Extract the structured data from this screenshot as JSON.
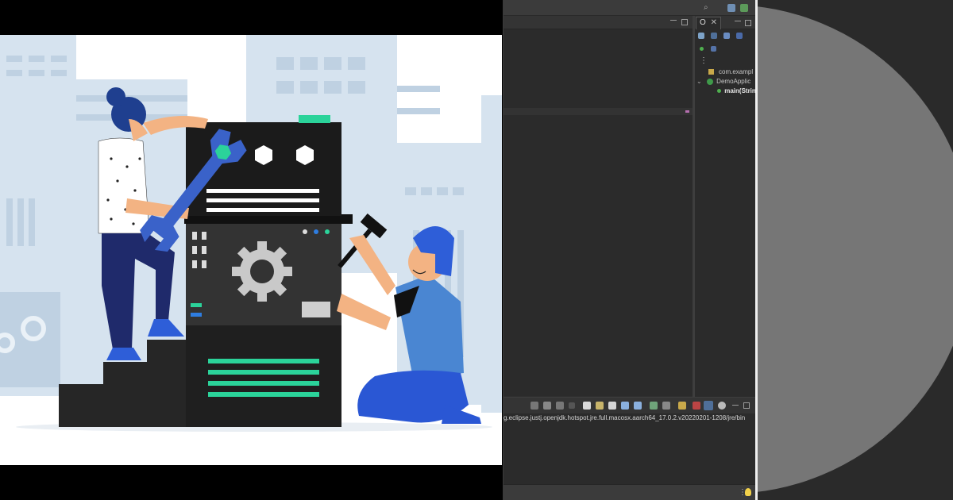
{
  "illustration": {
    "colors": {
      "background": "#ffffff",
      "buildings": "#d6e3ef",
      "buildings_dark": "#bfd1e2",
      "machine": "#262626",
      "machine_top": "#1b1b1b",
      "accent_green": "#2bd39a",
      "accent_blue": "#2e5ed8",
      "wrench": "#3a62c9",
      "woman_pants": "#1f2a6b",
      "man_shirt": "#4a86d2",
      "man_pants": "#2a57d4",
      "skin": "#f3b383",
      "hair": "#1f3f8f"
    },
    "icons": [
      "gear-icon",
      "hexagon-icon",
      "wrench-icon",
      "hammer-icon"
    ]
  },
  "ide": {
    "outline_tab_label": "O",
    "tree": {
      "package": "com.exampl",
      "class": "DemoApplic",
      "method": "main(Strin"
    },
    "console_path": "g.eclipse.justj.openjdk.hotspot.jre.full.macosx.aarch64_17.0.2.v20220201-1208/jre/bin",
    "colors": {
      "editor": "#2b2b2b",
      "chrome": "#3b3b3b",
      "text": "#d4d4d4"
    }
  },
  "disc": {
    "colors": {
      "background": "#2a2a2a",
      "disc_fill": "#767676"
    }
  }
}
